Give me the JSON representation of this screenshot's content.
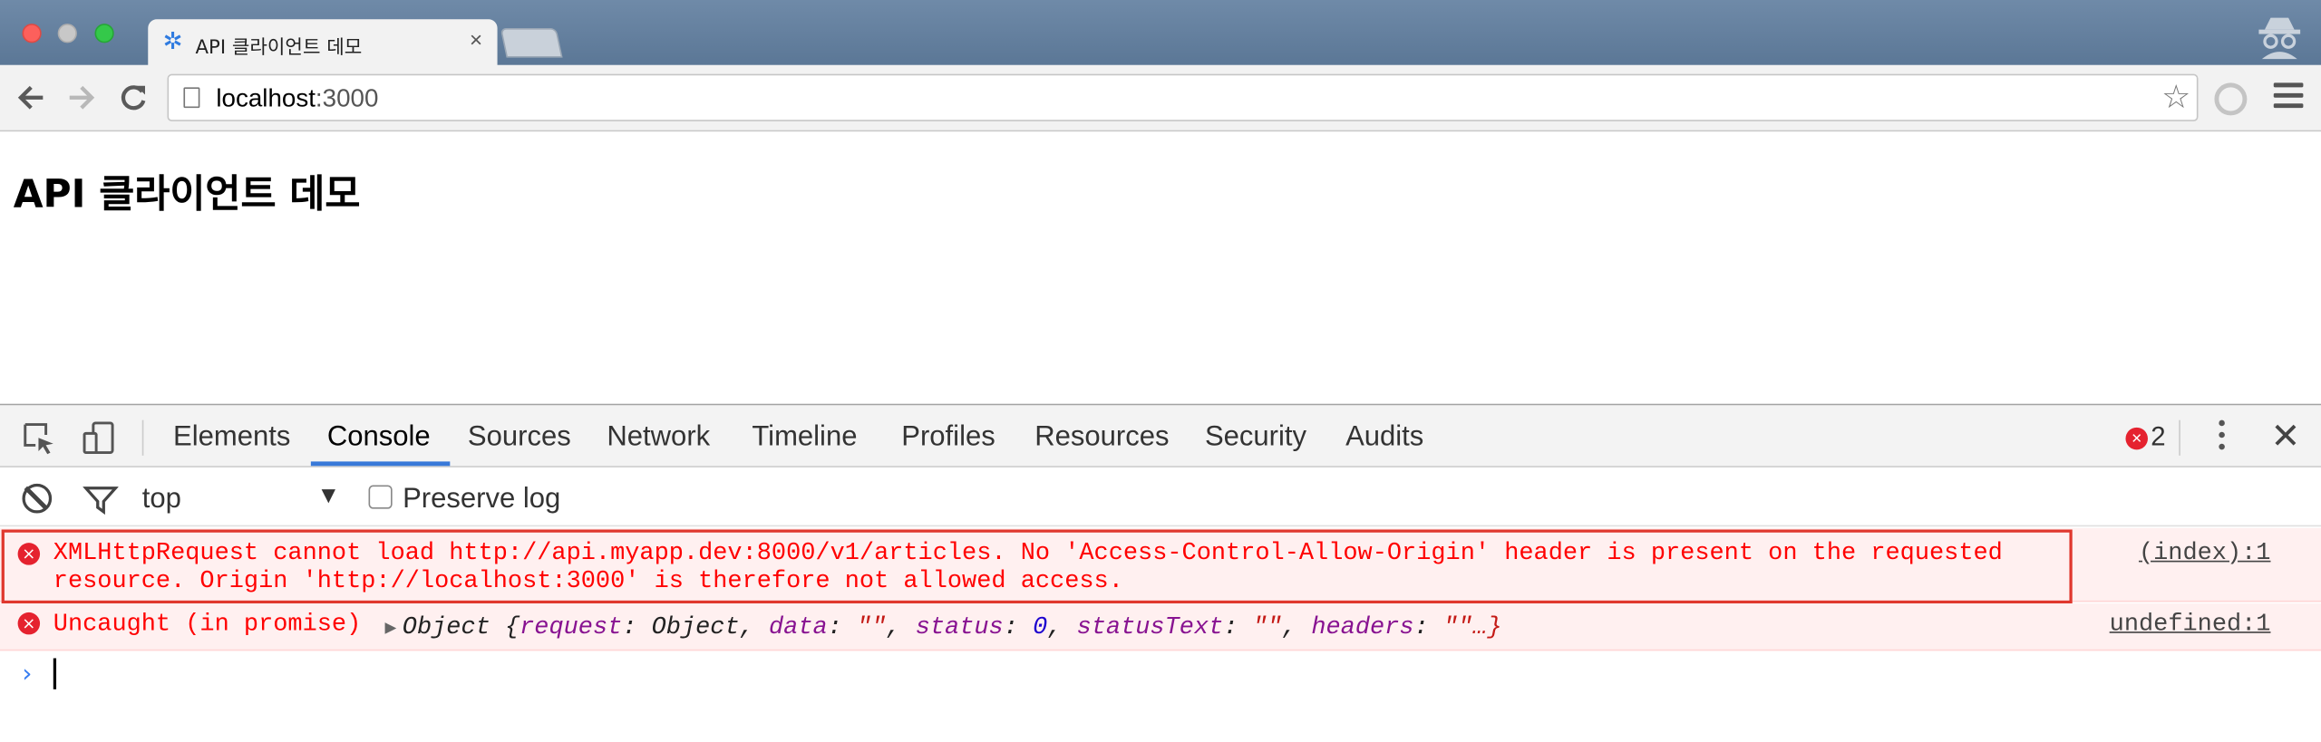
{
  "browser": {
    "tab_title": "API 클라이언트 데모",
    "tab_close": "×",
    "url_host": "localhost",
    "url_port": ":3000"
  },
  "page": {
    "heading": "API 클라이언트 데모"
  },
  "devtools": {
    "tabs": [
      "Elements",
      "Console",
      "Sources",
      "Network",
      "Timeline",
      "Profiles",
      "Resources",
      "Security",
      "Audits"
    ],
    "active_tab": "Console",
    "error_count": "2",
    "context": "top",
    "preserve_log_label": "Preserve log",
    "messages": [
      {
        "line1": "XMLHttpRequest cannot load http://api.myapp.dev:8000/v1/articles. No 'Access-Control-Allow-Origin' header is present on the requested",
        "line2": "resource. Origin 'http://localhost:3000' is therefore not allowed access.",
        "source": "(index):1"
      },
      {
        "label": "Uncaught (in promise)",
        "object_prefix": "Object {",
        "k1": "request",
        "v1": "Object",
        "k2": "data",
        "v2": "\"\"",
        "k3": "status",
        "v3": "0",
        "k4": "statusText",
        "v4": "\"\"",
        "k5": "headers",
        "v5": "\"\"…}",
        "source": "undefined:1"
      }
    ],
    "prompt": "›"
  },
  "colors": {
    "error_red": "#ff0000",
    "active_tab_underline": "#3879d9",
    "error_bg": "#fff0f0"
  }
}
